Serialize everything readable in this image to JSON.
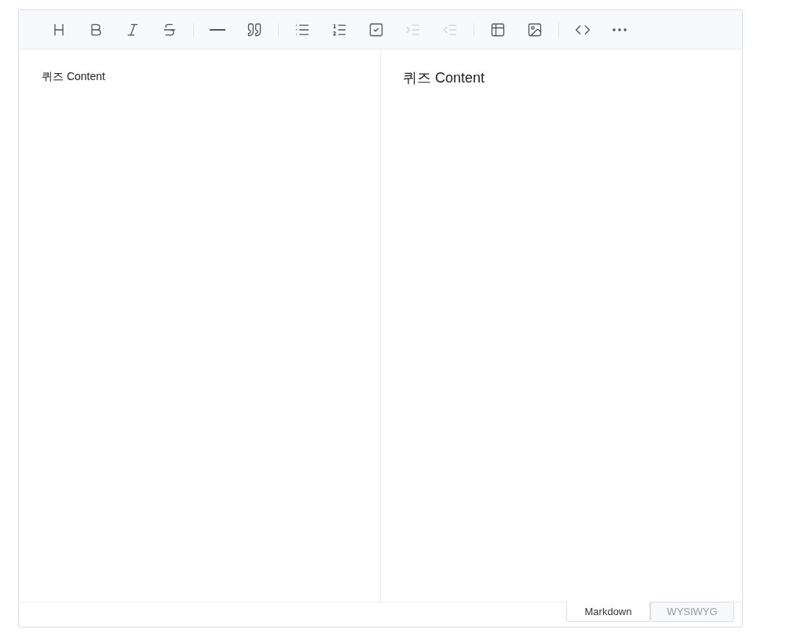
{
  "toolbar": {
    "groups": [
      {
        "items": [
          {
            "kind": "heading",
            "disabled": false
          },
          {
            "kind": "bold",
            "disabled": false
          },
          {
            "kind": "italic",
            "disabled": false
          },
          {
            "kind": "strike",
            "disabled": false
          }
        ]
      },
      {
        "items": [
          {
            "kind": "hr",
            "disabled": false
          },
          {
            "kind": "quote",
            "disabled": false
          }
        ]
      },
      {
        "items": [
          {
            "kind": "bullet-list",
            "disabled": false
          },
          {
            "kind": "ordered-list",
            "disabled": false
          },
          {
            "kind": "task",
            "disabled": false
          },
          {
            "kind": "indent",
            "disabled": true
          },
          {
            "kind": "outdent",
            "disabled": true
          }
        ]
      },
      {
        "items": [
          {
            "kind": "table",
            "disabled": false
          },
          {
            "kind": "image",
            "disabled": false
          }
        ]
      },
      {
        "items": [
          {
            "kind": "code",
            "disabled": false
          },
          {
            "kind": "more",
            "disabled": false
          }
        ]
      }
    ]
  },
  "markdown_pane": {
    "text": "퀴즈 Content"
  },
  "preview_pane": {
    "text": "퀴즈 Content"
  },
  "mode_tabs": [
    {
      "label": "Markdown",
      "selected": true
    },
    {
      "label": "WYSIWYG",
      "selected": false
    }
  ]
}
